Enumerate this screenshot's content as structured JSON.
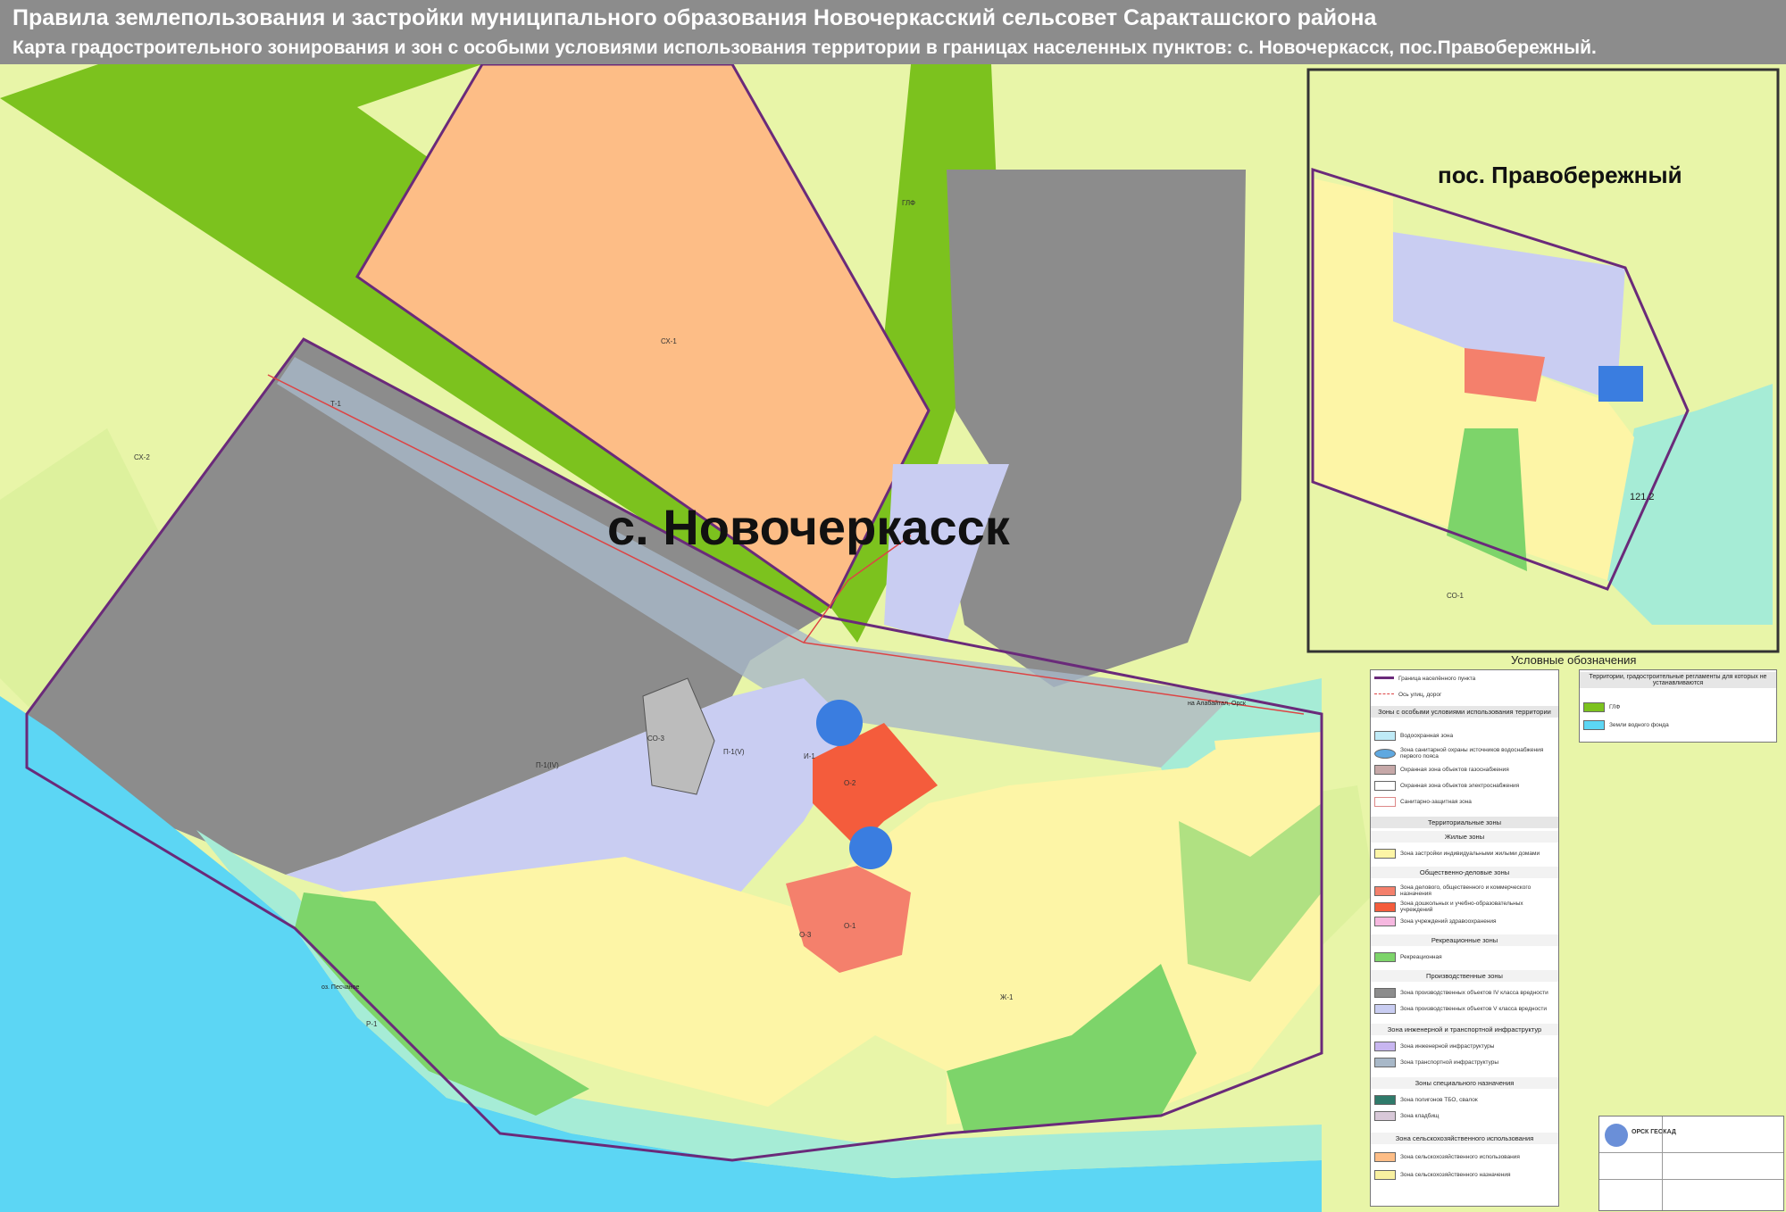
{
  "header": {
    "title": "Правила землепользования и застройки муниципального образования Новочеркасский сельсовет Саракташского района",
    "subtitle": "Карта градостроительного зонирования и зон с особыми условиями использования территории в границах населенных пунктов: с. Новочеркасск, пос.Правобережный."
  },
  "map": {
    "main_label": "с. Новочеркасск",
    "inset_label": "пос. Правобережный",
    "road_label": "на Алабайтал, Орск",
    "elevation_label": "121.2",
    "lake_label": "оз. Песчаное",
    "zone_labels": [
      "СХ-1",
      "СХ-2",
      "Т-1",
      "Ж-1",
      "О-1",
      "О-2",
      "О-3",
      "Р-1",
      "П-1(IV)",
      "П-1(V)",
      "СО-3",
      "И-1",
      "ГЛФ",
      "СО-1"
    ],
    "colors": {
      "agri": "#e8f5a8",
      "forest": "#7cc21e",
      "cx1": "#fdbd86",
      "industrial": "#8c8c8c",
      "residential": "#fdf5a6",
      "recreation": "#7dd46a",
      "water": "#5cd6f4",
      "river_buffer": "#a6ecd6",
      "industrial5": "#c9cdf2",
      "public": "#f4806c",
      "water_fund": "#3a7de0",
      "boundary": "#6a2a7a"
    }
  },
  "legend": {
    "title": "Условные обозначения",
    "items": [
      {
        "label": "Граница населённого пункта",
        "color": "#6a2a7a"
      },
      {
        "label": "Ось улиц, дорог",
        "color": "#d44"
      },
      {
        "label": "Зоны с особыми условиями использования территории",
        "color": ""
      },
      {
        "label": "Водоохранная зона",
        "color": "#bfeaf6"
      },
      {
        "label": "Зона санитарной охраны источников водоснабжения первого пояса",
        "color": "#5fa8e0"
      },
      {
        "label": "Охранная зона объектов газоснабжения",
        "color": "#c6a8a8"
      },
      {
        "label": "Охранная зона объектов электроснабжения",
        "color": "#ffffff"
      },
      {
        "label": "Санитарно-защитная зона",
        "color": "#ffffff"
      },
      {
        "label": "Территориальные зоны",
        "color": ""
      },
      {
        "label": "Жилые зоны",
        "color": ""
      },
      {
        "label": "Зона застройки индивидуальными жилыми домами",
        "color": "#fdf5a6"
      },
      {
        "label": "Общественно-деловые зоны",
        "color": ""
      },
      {
        "label": "Зона делового, общественного и коммерческого назначения",
        "color": "#f4806c"
      },
      {
        "label": "Зона дошкольных и учебно-образовательных учреждений",
        "color": "#f45c3c"
      },
      {
        "label": "Зона учреждений здравоохранения",
        "color": "#f6b8e0"
      },
      {
        "label": "Рекреационные зоны",
        "color": ""
      },
      {
        "label": "Рекреационная",
        "color": "#7dd46a"
      },
      {
        "label": "Производственные зоны",
        "color": ""
      },
      {
        "label": "Зона производственных объектов IV класса вредности",
        "color": "#8c8c8c"
      },
      {
        "label": "Зона производственных объектов V класса вредности",
        "color": "#c9cdf2"
      },
      {
        "label": "Зона инженерной и транспортной инфраструктур",
        "color": ""
      },
      {
        "label": "Зона инженерной инфраструктуры",
        "color": "#c8b6f0"
      },
      {
        "label": "Зона транспортной инфраструктуры",
        "color": "#a8b8c8"
      },
      {
        "label": "Зоны специального назначения",
        "color": ""
      },
      {
        "label": "Зона полигонов ТБО, свалок",
        "color": "#2f7a6a"
      },
      {
        "label": "Зона кладбищ",
        "color": "#d8c8d8"
      },
      {
        "label": "Зона сельскохозяйственного использования",
        "color": ""
      },
      {
        "label": "Зона сельскохозяйственного использования",
        "color": "#fdbd86"
      },
      {
        "label": "Зона сельскохозяйственного назначения",
        "color": "#f8f0a0"
      }
    ],
    "right_title": "Территории, градостроительные регламенты для которых не устанавливаются",
    "right_items": [
      {
        "label": "ГЛФ",
        "color": "#7cc21e"
      },
      {
        "label": "Земли водного фонда",
        "color": "#5cd6f4"
      }
    ]
  },
  "stamp": {
    "org": "ОРСК ГЕОКАД"
  }
}
